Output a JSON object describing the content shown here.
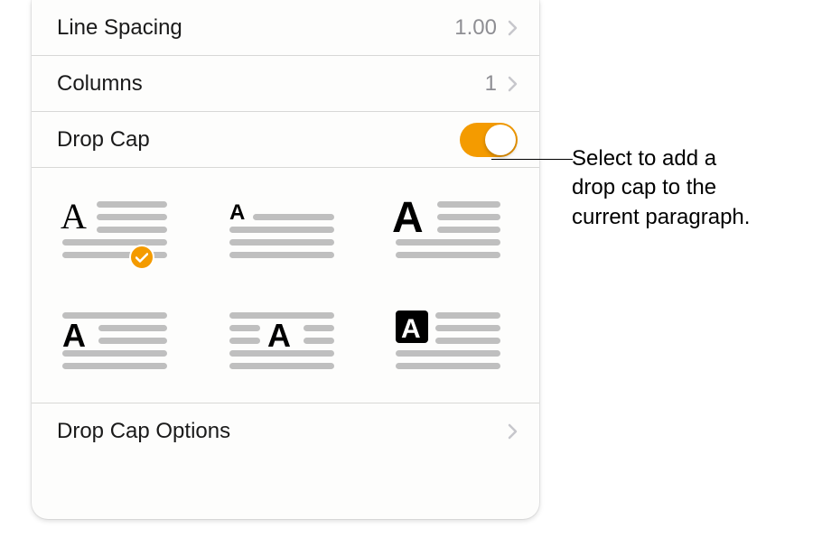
{
  "rows": {
    "lineSpacing": {
      "label": "Line Spacing",
      "value": "1.00"
    },
    "columns": {
      "label": "Columns",
      "value": "1"
    },
    "dropCap": {
      "label": "Drop Cap",
      "enabled": true
    },
    "dropCapOptions": {
      "label": "Drop Cap Options"
    }
  },
  "callout": {
    "line1": "Select to add a",
    "line2": "drop cap to the",
    "line3": "current paragraph."
  },
  "colors": {
    "accent": "#f49b00"
  },
  "dropCapStyles": {
    "selectedIndex": 0
  }
}
